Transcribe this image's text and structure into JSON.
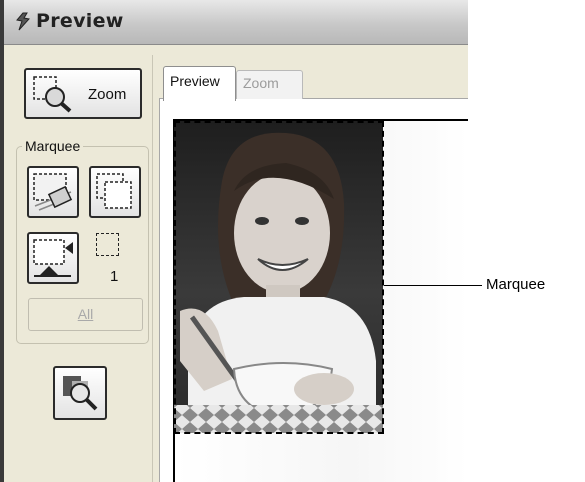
{
  "window": {
    "title": "Preview"
  },
  "toolbar": {
    "zoom_label": "Zoom"
  },
  "marquee_group": {
    "label": "Marquee",
    "count": "1",
    "all_label": "All"
  },
  "tabs": [
    {
      "label": "Preview",
      "active": true
    },
    {
      "label": "Zoom",
      "active": false
    }
  ],
  "callout": {
    "label": "Marquee"
  },
  "colors": {
    "window_bg": "#ece9d8",
    "panel_bg": "#ffffff",
    "disabled_text": "#a9a9a9"
  }
}
